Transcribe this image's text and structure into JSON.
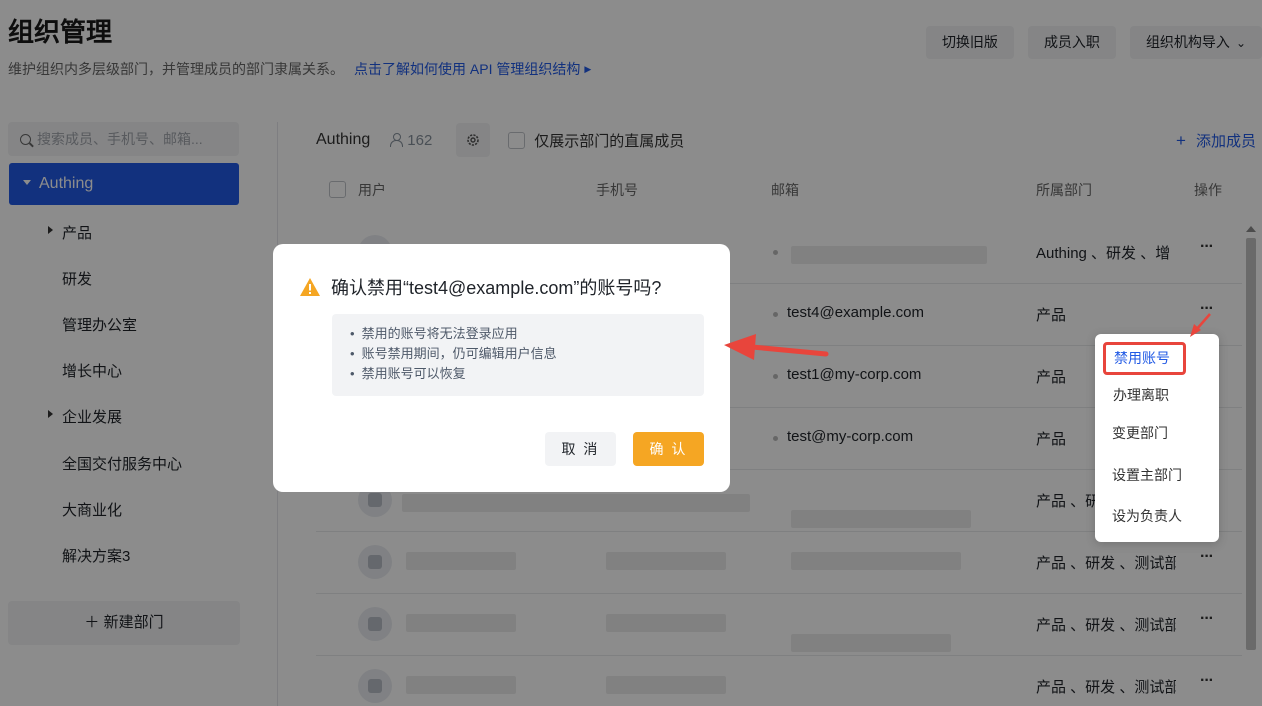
{
  "header": {
    "title": "组织管理",
    "description": "维护组织内多层级部门，并管理成员的部门隶属关系。",
    "help_link": "点击了解如何使用 API 管理组织结构",
    "buttons": [
      "切换旧版",
      "成员入职",
      "组织机构导入"
    ]
  },
  "sidebar": {
    "search_placeholder": "搜索成员、手机号、邮箱...",
    "root": "Authing",
    "items": [
      "产品",
      "研发",
      "管理办公室",
      "增长中心",
      "企业发展",
      "全国交付服务中心",
      "大商业化",
      "解决方案3"
    ],
    "new_dept": "新建部门"
  },
  "toolbar": {
    "org_name": "Authing",
    "member_count": "162",
    "direct_only_label": "仅展示部门的直属成员",
    "add_member": "添加成员"
  },
  "table": {
    "columns": [
      "用户",
      "手机号",
      "邮箱",
      "所属部门",
      "操作"
    ],
    "rows": [
      {
        "email": "",
        "dept": "Authing 、研发 、增"
      },
      {
        "email": "test4@example.com",
        "dept": "产品"
      },
      {
        "email": "test1@my-corp.com",
        "dept": "产品"
      },
      {
        "email": "test@my-corp.com",
        "dept": "产品"
      },
      {
        "email": "",
        "dept": "产品 、研"
      },
      {
        "email": "",
        "dept": "产品 、研发 、测试部"
      },
      {
        "email": "",
        "dept": "产品 、研发 、测试部"
      },
      {
        "email": "",
        "dept": "产品 、研发 、测试部"
      }
    ],
    "more": "···"
  },
  "row_menu": {
    "items": [
      "禁用账号",
      "办理离职",
      "变更部门",
      "设置主部门",
      "设为负责人"
    ]
  },
  "dialog": {
    "title": "确认禁用“test4@example.com”的账号吗?",
    "bullets": [
      "禁用的账号将无法登录应用",
      "账号禁用期间，仍可编辑用户信息",
      "禁用账号可以恢复"
    ],
    "cancel": "取 消",
    "confirm": "确 认"
  },
  "colors": {
    "primary": "#215ae5",
    "warning": "#f5a623",
    "annotation": "#e8453c"
  }
}
